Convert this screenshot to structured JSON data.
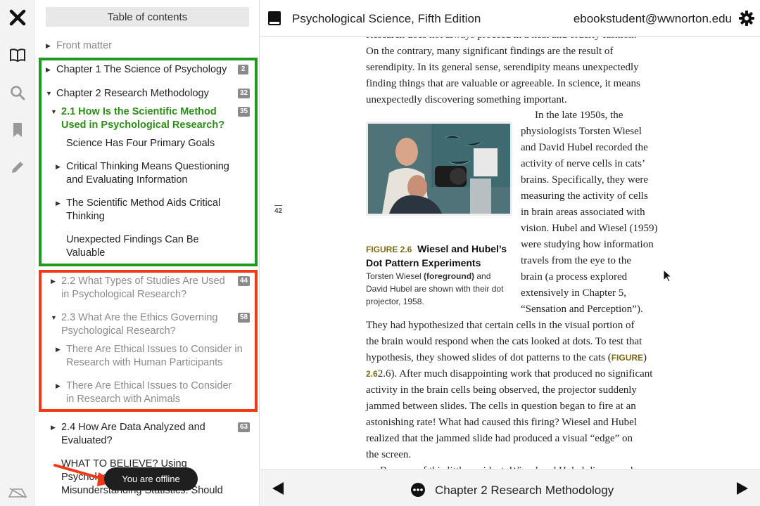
{
  "rail": {
    "icons": [
      "close-icon",
      "book-icon",
      "search-icon",
      "bookmark-icon",
      "pencil-icon",
      "offline-icon"
    ]
  },
  "toc": {
    "title": "Table of contents",
    "items": [
      {
        "label": "Front matter",
        "badge": ""
      },
      {
        "label": "Chapter 1 The Science of Psychology",
        "badge": "2"
      },
      {
        "label": "Chapter 2 Research Methodology",
        "badge": "32"
      },
      {
        "label": "2.1 How Is the Scientific Method Used in Psychological Research?",
        "badge": "35"
      },
      {
        "label": "Science Has Four Primary Goals",
        "badge": ""
      },
      {
        "label": "Critical Thinking Means Questioning and Evaluating Information",
        "badge": ""
      },
      {
        "label": "The Scientific Method Aids Critical Thinking",
        "badge": ""
      },
      {
        "label": "Unexpected Findings Can Be Valuable",
        "badge": ""
      },
      {
        "label": "2.2 What Types of Studies Are Used in Psychological Research?",
        "badge": "44"
      },
      {
        "label": "2.3 What Are the Ethics Governing Psychological Research?",
        "badge": "58"
      },
      {
        "label": "There Are Ethical Issues to Consider in Research with Human Participants",
        "badge": ""
      },
      {
        "label": "There Are Ethical Issues to Consider in Research with Animals",
        "badge": ""
      },
      {
        "label": "2.4 How Are Data Analyzed and Evaluated?",
        "badge": "63"
      },
      {
        "label": "WHAT TO BELIEVE? Using Psychological Reasoning: Misunderstanding Statistics: Should",
        "badge": ""
      }
    ],
    "highlight_colors": {
      "green": "#1f9a1f",
      "red": "#f03a17"
    }
  },
  "toast": {
    "text": "You are offline"
  },
  "header": {
    "book_title": "Psychological Science, Fifth Edition",
    "user_email": "ebookstudent@wwnorton.edu"
  },
  "footer": {
    "chapter": "Chapter 2 Research Methodology"
  },
  "page": {
    "page_number": "42",
    "top_lines": [
      "Research does not always proceed in a neat and orderly fashion.",
      "On the contrary, many significant findings are the result of",
      "serendipity. In its general sense, serendipity means unexpectedly",
      "finding things that are valuable or agreeable. In science, it means",
      "unexpectedly discovering something important."
    ],
    "side_lines": [
      "In the late 1950s, the",
      "physiologists Torsten Wiesel",
      "and David Hubel recorded the",
      "activity of nerve cells in cats’",
      "brains. Specifically, they were",
      "measuring the activity of cells",
      "in brain areas associated with",
      "vision. Hubel and Wiesel (1959)",
      "were studying how information",
      "travels from the eye to the",
      "brain (a process explored",
      "extensively in Chapter 5,",
      "“Sensation and Perception”)."
    ],
    "figure": {
      "number": "FIGURE 2.6",
      "title": "Wiesel and Hubel’s Dot Pattern Experiments",
      "caption_pre": "Torsten Wiesel ",
      "caption_bold": "(foreground)",
      "caption_post": " and David Hubel are shown with their dot projector, 1958."
    },
    "bottom_lines": [
      "They had hypothesized that certain cells in the visual portion of",
      "the brain would respond when the cats looked at dots. To test that",
      "hypothesis, they showed slides of dot patterns to the cats (",
      "2.6). After much disappointing work that produced no significant",
      "activity in the brain cells being observed, the projector suddenly",
      "jammed between slides. The cells in question began to fire at an",
      "astonishing rate! What had caused this firing? Wiesel and Hubel",
      "realized that the jammed slide had produced a visual “edge” on",
      "the screen.",
      "Because of this little accident, Wiesel and Hubel discovered"
    ],
    "figref_a": "FIGURE",
    "figref_b": "2.6"
  }
}
